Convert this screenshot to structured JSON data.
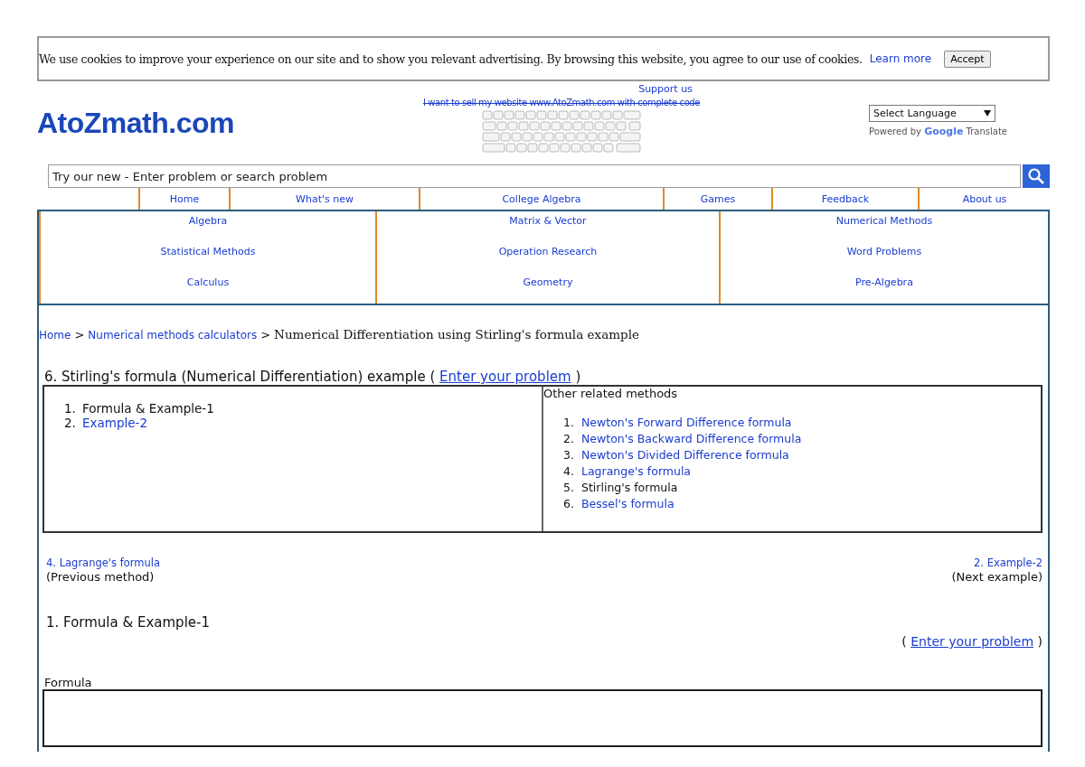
{
  "cookie_bar": {
    "text": "We use cookies to improve your experience on our site and to show you relevant advertising. By browsing this website, you agree to our use of cookies.",
    "link": "Learn more",
    "button": "Accept"
  },
  "header": {
    "logo": "AtoZmath.com",
    "support": "Support us",
    "sell_notice": "I want to sell my website www.AtoZmath.com with complete code",
    "language_select": "Select Language",
    "powered_by": "Powered by",
    "google": "Google",
    "translate": "Translate"
  },
  "search": {
    "placeholder": "Try our new - Enter problem or search problem"
  },
  "nav": [
    "Home",
    "What's new",
    "College Algebra",
    "Games",
    "Feedback",
    "About us"
  ],
  "categories": [
    [
      "Algebra",
      "Matrix & Vector",
      "Numerical Methods"
    ],
    [
      "Statistical Methods",
      "Operation Research",
      "Word Problems"
    ],
    [
      "Calculus",
      "Geometry",
      "Pre-Algebra"
    ]
  ],
  "breadcrumb": {
    "links": [
      {
        "label": "Home",
        "separator": ">"
      },
      {
        "label": "Numerical methods calculators",
        "separator": ">"
      }
    ],
    "current": "Numerical Differentiation using Stirling's formula example"
  },
  "heading": {
    "text": "6. Stirling's formula (Numerical Differentiation) example (",
    "link": "Enter your problem",
    "close": ")"
  },
  "examples": [
    {
      "number": "1.",
      "label": "Formula & Example-1",
      "selected": true
    },
    {
      "number": "2.",
      "label": "Example-2",
      "selected": false
    }
  ],
  "related": {
    "title": "Other related methods",
    "items": [
      {
        "number": "1.",
        "label": "Newton's Forward Difference formula",
        "selected": false
      },
      {
        "number": "2.",
        "label": "Newton's Backward Difference formula",
        "selected": false
      },
      {
        "number": "3.",
        "label": "Newton's Divided Difference formula",
        "selected": false
      },
      {
        "number": "4.",
        "label": "Lagrange's formula",
        "selected": false
      },
      {
        "number": "5.",
        "label": "Stirling's formula",
        "selected": true
      },
      {
        "number": "6.",
        "label": "Bessel's formula",
        "selected": false
      }
    ]
  },
  "prev": {
    "link": "4. Lagrange's formula",
    "caption": "(Previous method)"
  },
  "next": {
    "link": "2. Example-2",
    "caption": "(Next example)"
  },
  "section_title": "1. Formula & Example-1",
  "enter_problem": {
    "open": "(",
    "link": "Enter your problem",
    "close": ")"
  },
  "formula_label": "Formula"
}
